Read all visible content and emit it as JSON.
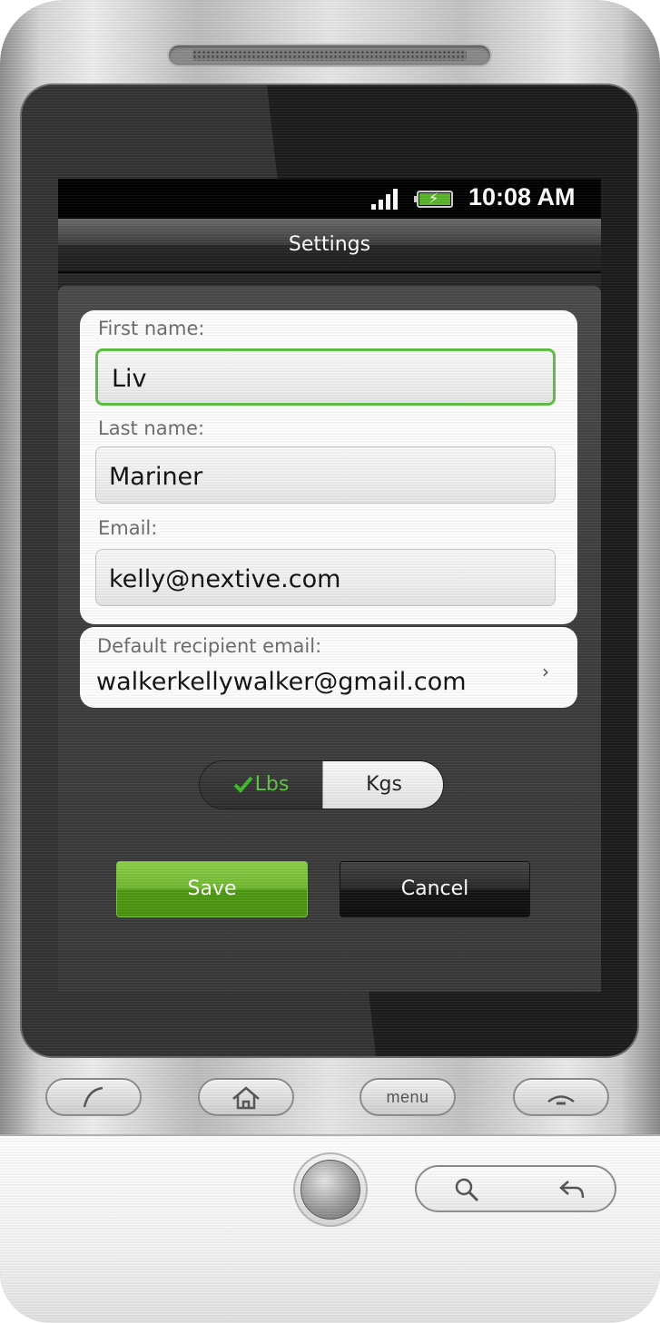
{
  "statusbar": {
    "time": "10:08 AM"
  },
  "titlebar": {
    "title": "Settings"
  },
  "form": {
    "first_name": {
      "label": "First name:",
      "value": "Liv"
    },
    "last_name": {
      "label": "Last name:",
      "value": "Mariner"
    },
    "email": {
      "label": "Email:",
      "value": "kelly@nextive.com"
    }
  },
  "recipient": {
    "label": "Default recipient email:",
    "value": "walkerkellywalker@gmail.com"
  },
  "units": {
    "options": [
      "Lbs",
      "Kgs"
    ],
    "selected": "Lbs"
  },
  "actions": {
    "save_label": "Save",
    "cancel_label": "Cancel"
  },
  "hardware_keys": {
    "menu_label": "menu"
  },
  "colors": {
    "accent_green": "#5fbf42",
    "save_green": "#6db52c",
    "statusbar_bg": "#000000"
  },
  "icons": [
    "signal-icon",
    "battery-icon",
    "chevron-right-icon",
    "checkmark-icon",
    "phone-call-icon",
    "home-icon",
    "end-call-icon",
    "search-icon",
    "back-icon"
  ]
}
